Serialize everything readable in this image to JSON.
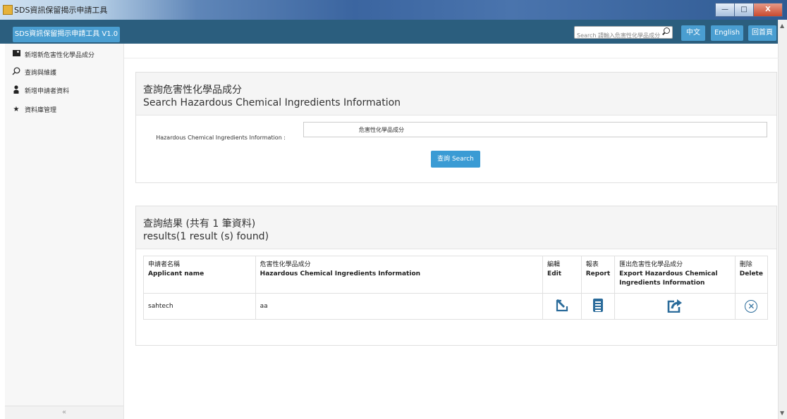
{
  "window": {
    "title": "SDS資訊保留揭示申請工具",
    "btn_min": "—",
    "btn_max": "□",
    "btn_close": "X"
  },
  "navbar": {
    "brand": "SDS資訊保留揭示申請工具 V1.0",
    "search_placeholder": "Search 請輸入危害性化學品成分",
    "lang_zh": "中文",
    "lang_en": "English",
    "home": "回首頁"
  },
  "sidebar": {
    "items": [
      {
        "label": "新增新危害性化學品成分",
        "icon": "add-square-icon"
      },
      {
        "label": "查詢與維護",
        "icon": "search-icon"
      },
      {
        "label": "新增申請者資料",
        "icon": "user-icon"
      },
      {
        "label": "資料庫管理",
        "icon": "star-icon"
      }
    ],
    "collapse": "«"
  },
  "search_panel": {
    "title_zh": "查詢危害性化學品成分",
    "title_en": "Search Hazardous Chemical Ingredients Information",
    "field_label_zh": "危害性化學品成分",
    "field_label_en": "Hazardous Chemical Ingredients Information :",
    "field_value": "",
    "button": "查詢 Search"
  },
  "results_panel": {
    "title_zh": "查詢結果 (共有 1 筆資料)",
    "title_en": "results(1 result (s) found)",
    "columns": [
      {
        "zh": "申請者名稱",
        "en": "Applicant name"
      },
      {
        "zh": "危害性化學品成分",
        "en": "Hazardous Chemical Ingredients Information"
      },
      {
        "zh": "編輯",
        "en": "Edit"
      },
      {
        "zh": "報表",
        "en": "Report"
      },
      {
        "zh": "匯出危害性化學品成分",
        "en": "Export Hazardous Chemical Ingredients Information"
      },
      {
        "zh": "刪除",
        "en": "Delete"
      }
    ],
    "rows": [
      {
        "applicant": "sahtech",
        "ingredient": "aa"
      }
    ]
  },
  "colors": {
    "navbar": "#2b5e7e",
    "accent": "#3a9bd4",
    "icon": "#2a6b9a"
  }
}
